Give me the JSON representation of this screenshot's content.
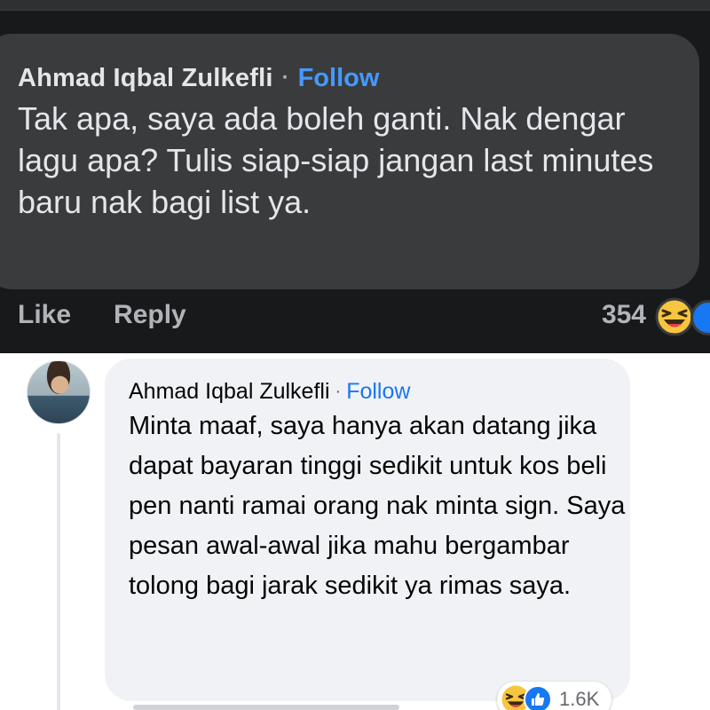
{
  "top_comment": {
    "author": "Ahmad Iqbal Zulkefli",
    "separator": "·",
    "follow_label": "Follow",
    "text": "Tak apa, saya ada boleh ganti. Nak dengar lagu apa? Tulis siap-siap jangan last minutes baru nak bagi list ya.",
    "like_label": "Like",
    "reply_label": "Reply",
    "reaction_count": "354",
    "reaction_icons": [
      "haha-emoji-icon",
      "like-reaction-icon"
    ],
    "colors": {
      "background": "#18191a",
      "bubble": "#3a3b3c",
      "text": "#e4e6eb",
      "follow": "#4599ff",
      "muted": "#b0b3b8"
    }
  },
  "bottom_comment": {
    "avatar": "author-avatar",
    "author": "Ahmad Iqbal Zulkefli",
    "separator": "·",
    "follow_label": "Follow",
    "text": "Minta maaf, saya hanya akan datang jika dapat bayaran tinggi sedikit untuk kos beli pen nanti ramai orang nak minta sign. Saya pesan awal-awal jika mahu bergambar tolong bagi jarak sedikit ya rimas saya.",
    "reaction_count": "1.6K",
    "reaction_icons": [
      "haha-emoji-icon",
      "like-reaction-icon"
    ],
    "colors": {
      "background": "#ffffff",
      "bubble": "#f0f2f5",
      "text": "#050505",
      "follow": "#1877f2",
      "muted": "#65676b"
    }
  }
}
